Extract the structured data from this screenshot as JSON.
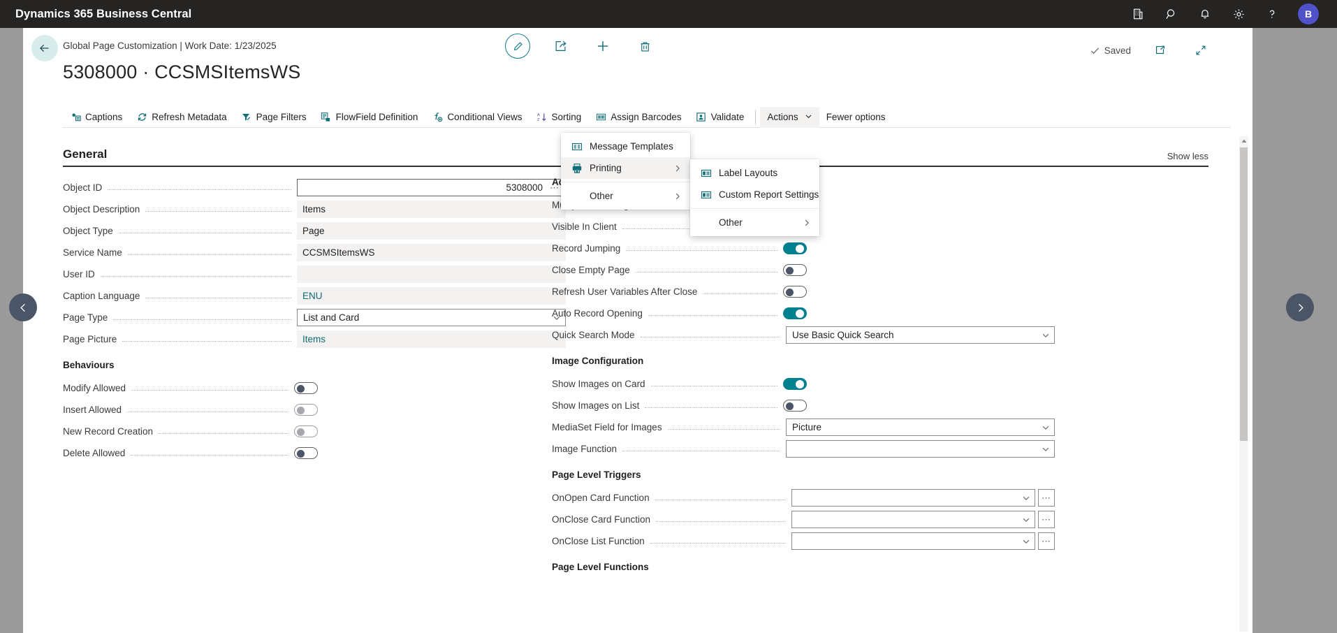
{
  "topbar": {
    "title": "Dynamics 365 Business Central",
    "icons": [
      "company-icon",
      "search-icon",
      "notification-bell-icon",
      "gear-icon",
      "help-icon"
    ],
    "avatar_initial": "B"
  },
  "header": {
    "back_label": "back-arrow",
    "breadcrumb": "Global Page Customization | Work Date: 1/23/2025",
    "title": "5308000 · CCSMSItemsWS",
    "actions": [
      "edit-pencil-icon",
      "share-icon",
      "new-plus-icon",
      "delete-trash-icon"
    ],
    "saved_label": "Saved",
    "open_new_window_label": "open-in-new-window-icon",
    "collapse_label": "collapse-icon"
  },
  "ribbon": {
    "items": [
      {
        "label": "Captions",
        "icon": "captions-icon"
      },
      {
        "label": "Refresh Metadata",
        "icon": "refresh-icon"
      },
      {
        "label": "Page Filters",
        "icon": "filter-icon"
      },
      {
        "label": "FlowField Definition",
        "icon": "flowfield-icon"
      },
      {
        "label": "Conditional Views",
        "icon": "function-icon"
      },
      {
        "label": "Sorting",
        "icon": "sort-az-icon"
      },
      {
        "label": "Assign Barcodes",
        "icon": "barcode-icon"
      },
      {
        "label": "Validate",
        "icon": "validate-icon"
      }
    ],
    "actions_label": "Actions",
    "fewer_options_label": "Fewer options"
  },
  "menus": {
    "actions_menu": [
      {
        "label": "Message Templates",
        "icon": "message-template-icon",
        "has_submenu": false,
        "highlighted": false
      },
      {
        "label": "Printing",
        "icon": "printer-icon",
        "has_submenu": true,
        "highlighted": true
      },
      {
        "label": "Other",
        "icon": "",
        "has_submenu": true,
        "highlighted": false
      }
    ],
    "printing_submenu": [
      {
        "label": "Label Layouts",
        "icon": "label-layout-icon",
        "has_submenu": false
      },
      {
        "label": "Custom Report Settings",
        "icon": "label-layout-icon",
        "has_submenu": false
      },
      {
        "label": "Other",
        "icon": "",
        "has_submenu": true
      }
    ]
  },
  "section": {
    "title": "General",
    "show_less_label": "Show less"
  },
  "left_column": {
    "fields": [
      {
        "label": "Object ID",
        "value": "5308000",
        "type": "focused-input",
        "has_assist": true
      },
      {
        "label": "Object Description",
        "value": "Items",
        "type": "readonly"
      },
      {
        "label": "Object Type",
        "value": "Page",
        "type": "readonly"
      },
      {
        "label": "Service Name",
        "value": "CCSMSItemsWS",
        "type": "readonly"
      },
      {
        "label": "User ID",
        "value": "",
        "type": "readonly"
      },
      {
        "label": "Caption Language",
        "value": "ENU",
        "type": "readonly-link"
      },
      {
        "label": "Page Type",
        "value": "List and Card",
        "type": "combo"
      },
      {
        "label": "Page Picture",
        "value": "Items",
        "type": "readonly-link"
      }
    ],
    "behaviours_heading": "Behaviours",
    "behaviours": [
      {
        "label": "Modify Allowed",
        "state": "off"
      },
      {
        "label": "Insert Allowed",
        "state": "off-disabled"
      },
      {
        "label": "New Record Creation",
        "state": "off-disabled"
      },
      {
        "label": "Delete Allowed",
        "state": "off"
      }
    ]
  },
  "right_column": {
    "additional_heading": "Additional",
    "fields_top": [
      {
        "label": "Multiple Lines Page",
        "state": "on",
        "type": "toggle"
      },
      {
        "label": "Visible In Client",
        "state": "on",
        "type": "toggle"
      },
      {
        "label": "Record Jumping",
        "state": "on",
        "type": "toggle"
      },
      {
        "label": "Close Empty Page",
        "state": "off",
        "type": "toggle"
      },
      {
        "label": "Refresh User Variables After Close",
        "state": "off",
        "type": "toggle"
      },
      {
        "label": "Auto Record Opening",
        "state": "on",
        "type": "toggle"
      },
      {
        "label": "Quick Search Mode",
        "value": "Use Basic Quick Search",
        "type": "combo"
      }
    ],
    "image_heading": "Image Configuration",
    "image_fields": [
      {
        "label": "Show Images on Card",
        "state": "on",
        "type": "toggle"
      },
      {
        "label": "Show Images on List",
        "state": "off",
        "type": "toggle"
      },
      {
        "label": "MediaSet Field for Images",
        "value": "Picture",
        "type": "combo"
      },
      {
        "label": "Image Function",
        "value": "",
        "type": "combo"
      }
    ],
    "triggers_heading": "Page Level Triggers",
    "trigger_fields": [
      {
        "label": "OnOpen Card Function",
        "value": "",
        "type": "combo-assist"
      },
      {
        "label": "OnClose Card Function",
        "value": "",
        "type": "combo-assist"
      },
      {
        "label": "OnClose List Function",
        "value": "",
        "type": "combo-assist"
      }
    ],
    "functions_heading": "Page Level Functions"
  },
  "nav": {
    "prev_label": "previous-record",
    "next_label": "next-record"
  },
  "colors": {
    "brand_teal": "#00818f",
    "topbar_bg": "#252423",
    "avatar_bg": "#4f52c8",
    "nav_circle": "#4a5568"
  }
}
